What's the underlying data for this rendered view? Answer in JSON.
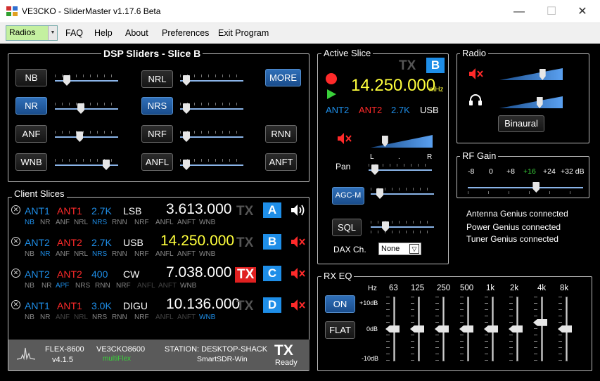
{
  "window": {
    "title": "VE3CKO - SliderMaster    v1.17.6 Beta",
    "minimize": "—",
    "maximize": "☐",
    "close": "✕"
  },
  "menu": {
    "radios": "Radios",
    "faq": "FAQ",
    "help": "Help",
    "about": "About",
    "preferences": "Preferences",
    "exit": "Exit Program"
  },
  "dsp": {
    "title": "DSP Sliders - Slice B",
    "nb": "NB",
    "nr": "NR",
    "anf": "ANF",
    "wnb": "WNB",
    "nrl": "NRL",
    "nrs": "NRS",
    "nrf": "NRF",
    "anfl": "ANFL",
    "more": "MORE",
    "rnn": "RNN",
    "anft": "ANFT",
    "levels": {
      "nb": 0.15,
      "nr": 0.4,
      "anf": 0.38,
      "wnb": 0.85,
      "nrl": 0.05,
      "nrs": 0.05,
      "nrf": 0.05,
      "anfl": 0.05
    },
    "nr_on": true,
    "nrs_on": true,
    "more_on": true
  },
  "active": {
    "title": "Active Slice",
    "tx": "TX",
    "letter": "B",
    "freq": "14.250.000",
    "unit": "mHz",
    "ant_rx": "ANT2",
    "ant_tx": "ANT2",
    "bw": "2.7K",
    "mode": "USB",
    "pan": "Pan",
    "pan_l": "L",
    "pan_r": "R",
    "agc": "AGC-M",
    "sql": "SQL",
    "dax": "DAX Ch.",
    "dax_val": "None",
    "vol_level": 0.2,
    "pan_level": 0.05,
    "agc_level": 0.1,
    "sql_level": 0.2
  },
  "radio": {
    "title": "Radio",
    "binaural": "Binaural",
    "speaker_level": 0.7,
    "phones_level": 0.65
  },
  "rfgain": {
    "title": "RF Gain",
    "ticks": [
      "-8",
      "0",
      "+8",
      "+16",
      "+24",
      "+32 dB"
    ],
    "selected": "+16",
    "level": 0.6
  },
  "genius": {
    "antenna": "Antenna Genius connected",
    "power": "Power Genius connected",
    "tuner": "Tuner Genius connected"
  },
  "slices": {
    "title": "Client Slices",
    "rows": [
      {
        "rx": "ANT1",
        "tx": "ANT1",
        "bw": "2.7K",
        "mode": "LSB",
        "freq": "3.613.000",
        "txl": "TX",
        "letter": "A",
        "audio": "on",
        "flags": [
          [
            "NB",
            "#1e8ee8"
          ],
          [
            "NR",
            "#888"
          ],
          [
            "ANF",
            "#888"
          ],
          [
            "NRL",
            "#888"
          ],
          [
            "NRS",
            "#1e8ee8"
          ],
          [
            "RNN",
            "#888"
          ],
          [
            "NRF",
            "#888"
          ],
          [
            "ANFL",
            "#888"
          ],
          [
            "ANFT",
            "#888"
          ],
          [
            "WNB",
            "#888"
          ]
        ]
      },
      {
        "rx": "ANT2",
        "tx": "ANT2",
        "bw": "2.7K",
        "mode": "USB",
        "freq": "14.250.000",
        "txl": "TX",
        "letter": "B",
        "audio": "muted",
        "flags": [
          [
            "NB",
            "#888"
          ],
          [
            "NR",
            "#1e8ee8"
          ],
          [
            "ANF",
            "#888"
          ],
          [
            "NRL",
            "#888"
          ],
          [
            "NRS",
            "#1e8ee8"
          ],
          [
            "RNN",
            "#888"
          ],
          [
            "NRF",
            "#888"
          ],
          [
            "ANFL",
            "#888"
          ],
          [
            "ANFT",
            "#888"
          ],
          [
            "WNB",
            "#888"
          ]
        ]
      },
      {
        "rx": "ANT2",
        "tx": "ANT2",
        "bw": "400",
        "mode": "CW",
        "freq": "7.038.000",
        "txl": "TX",
        "letter": "C",
        "audio": "muted",
        "flags": [
          [
            "NB",
            "#888"
          ],
          [
            "NR",
            "#888"
          ],
          [
            "APF",
            "#1e8ee8"
          ],
          [
            "NRS",
            "#888"
          ],
          [
            "RNN",
            "#888"
          ],
          [
            "NRF",
            "#888"
          ],
          [
            "ANFL",
            "#444"
          ],
          [
            "ANFT",
            "#444"
          ],
          [
            "WNB",
            "#888"
          ]
        ]
      },
      {
        "rx": "ANT1",
        "tx": "ANT1",
        "bw": "3.0K",
        "mode": "DIGU",
        "freq": "10.136.000",
        "txl": "TX",
        "letter": "D",
        "audio": "muted",
        "flags": [
          [
            "NB",
            "#888"
          ],
          [
            "NR",
            "#888"
          ],
          [
            "ANF",
            "#444"
          ],
          [
            "NRL",
            "#444"
          ],
          [
            "NRS",
            "#888"
          ],
          [
            "RNN",
            "#888"
          ],
          [
            "NRF",
            "#888"
          ],
          [
            "ANFL",
            "#444"
          ],
          [
            "ANFT",
            "#444"
          ],
          [
            "WNB",
            "#1e8ee8"
          ]
        ]
      }
    ]
  },
  "status": {
    "model": "FLEX-8600",
    "version": "v4.1.5",
    "callsign": "VE3CKO8600",
    "multiflex": "multiFlex",
    "station": "STATION: DESKTOP-SHACK",
    "client": "SmartSDR-Win",
    "tx": "TX",
    "ready": "Ready"
  },
  "eq": {
    "title": "RX EQ",
    "on": "ON",
    "flat": "FLAT",
    "hz": "Hz",
    "plus": "+10dB",
    "zero": "0dB",
    "minus": "-10dB",
    "bands": [
      {
        "label": "63",
        "value": 0
      },
      {
        "label": "125",
        "value": 0
      },
      {
        "label": "250",
        "value": 0
      },
      {
        "label": "500",
        "value": 0
      },
      {
        "label": "1k",
        "value": 0
      },
      {
        "label": "2k",
        "value": 0
      },
      {
        "label": "4k",
        "value": 0.2
      },
      {
        "label": "8k",
        "value": 0
      }
    ]
  },
  "colors": {
    "accent": "#1e8ee8",
    "freq_yellow": "#ffff3c",
    "red": "#ff2a2a",
    "green": "#3ad13a",
    "tx_active": "#e02020"
  }
}
